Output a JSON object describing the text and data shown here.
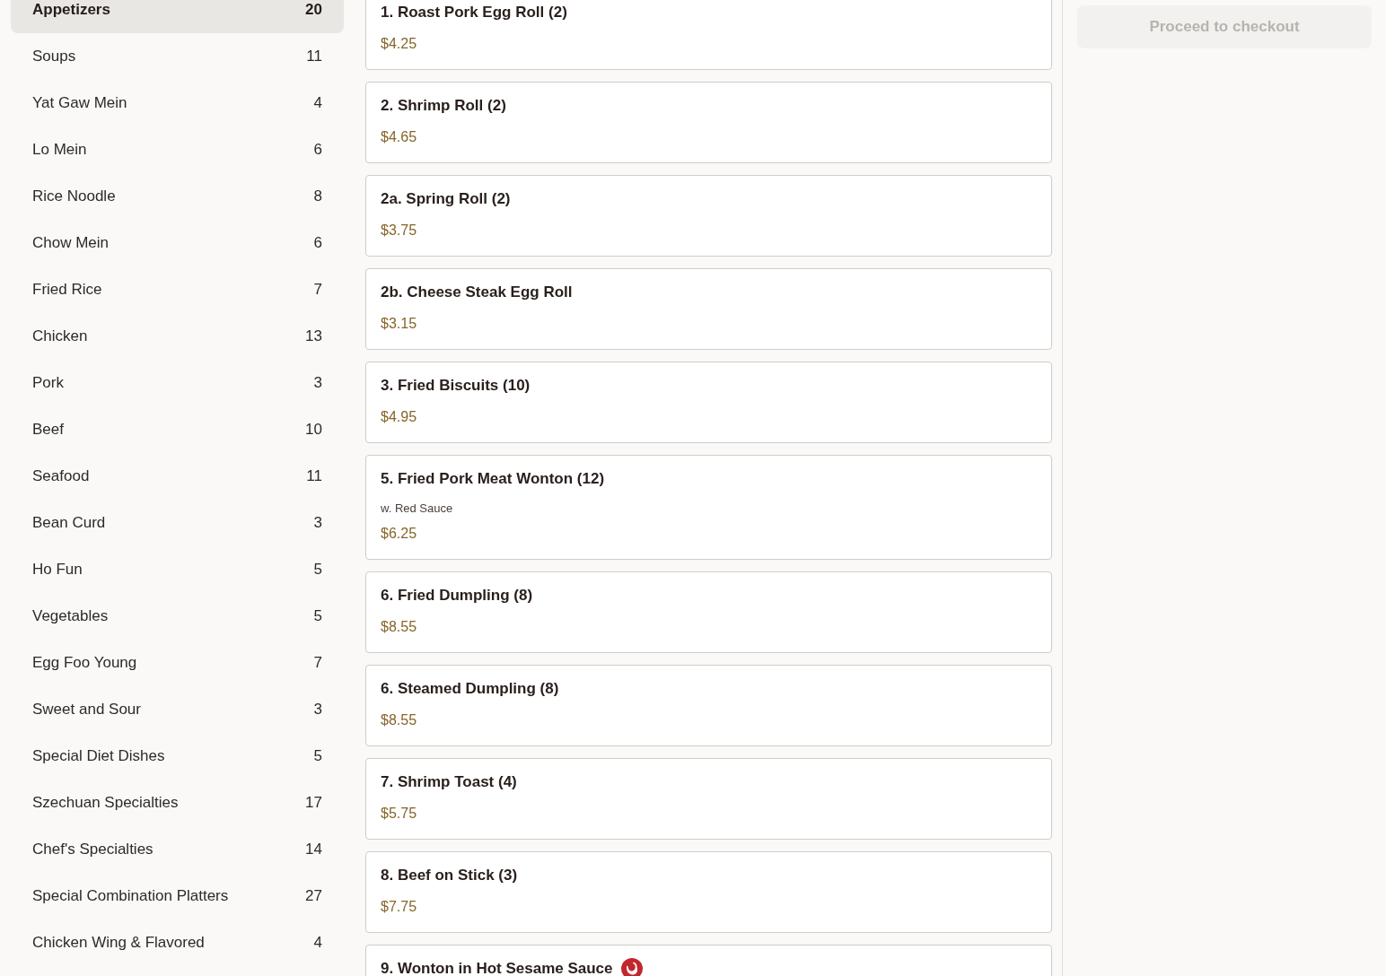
{
  "sidebar": {
    "categories": [
      {
        "label": "Appetizers",
        "count": "20",
        "selected": true
      },
      {
        "label": "Soups",
        "count": "11",
        "selected": false
      },
      {
        "label": "Yat Gaw Mein",
        "count": "4",
        "selected": false
      },
      {
        "label": "Lo Mein",
        "count": "6",
        "selected": false
      },
      {
        "label": "Rice Noodle",
        "count": "8",
        "selected": false
      },
      {
        "label": "Chow Mein",
        "count": "6",
        "selected": false
      },
      {
        "label": "Fried Rice",
        "count": "7",
        "selected": false
      },
      {
        "label": "Chicken",
        "count": "13",
        "selected": false
      },
      {
        "label": "Pork",
        "count": "3",
        "selected": false
      },
      {
        "label": "Beef",
        "count": "10",
        "selected": false
      },
      {
        "label": "Seafood",
        "count": "11",
        "selected": false
      },
      {
        "label": "Bean Curd",
        "count": "3",
        "selected": false
      },
      {
        "label": "Ho Fun",
        "count": "5",
        "selected": false
      },
      {
        "label": "Vegetables",
        "count": "5",
        "selected": false
      },
      {
        "label": "Egg Foo Young",
        "count": "7",
        "selected": false
      },
      {
        "label": "Sweet and Sour",
        "count": "3",
        "selected": false
      },
      {
        "label": "Special Diet Dishes",
        "count": "5",
        "selected": false
      },
      {
        "label": "Szechuan Specialties",
        "count": "17",
        "selected": false
      },
      {
        "label": "Chef's Specialties",
        "count": "14",
        "selected": false
      },
      {
        "label": "Special Combination Platters",
        "count": "27",
        "selected": false
      },
      {
        "label": "Chicken Wing & Flavored",
        "count": "4",
        "selected": false
      }
    ]
  },
  "menu_items": [
    {
      "name": "1. Roast Pork Egg Roll (2)",
      "price": "$4.25",
      "spicy": false
    },
    {
      "name": "2. Shrimp Roll (2)",
      "price": "$4.65",
      "spicy": false
    },
    {
      "name": "2a. Spring Roll (2)",
      "price": "$3.75",
      "spicy": false
    },
    {
      "name": "2b. Cheese Steak Egg Roll",
      "price": "$3.15",
      "spicy": false
    },
    {
      "name": "3. Fried Biscuits (10)",
      "price": "$4.95",
      "spicy": false
    },
    {
      "name": "5. Fried Pork Meat Wonton (12)",
      "description": "w. Red Sauce",
      "price": "$6.25",
      "spicy": false
    },
    {
      "name": "6. Fried Dumpling (8)",
      "price": "$8.55",
      "spicy": false
    },
    {
      "name": "6. Steamed Dumpling (8)",
      "price": "$8.55",
      "spicy": false
    },
    {
      "name": "7. Shrimp Toast (4)",
      "price": "$5.75",
      "spicy": false
    },
    {
      "name": "8. Beef on Stick (3)",
      "price": "$7.75",
      "spicy": false
    },
    {
      "name": "9. Wonton in Hot Sesame Sauce",
      "spicy": true
    }
  ],
  "checkout": {
    "label": "Proceed to checkout",
    "disabled": true
  }
}
